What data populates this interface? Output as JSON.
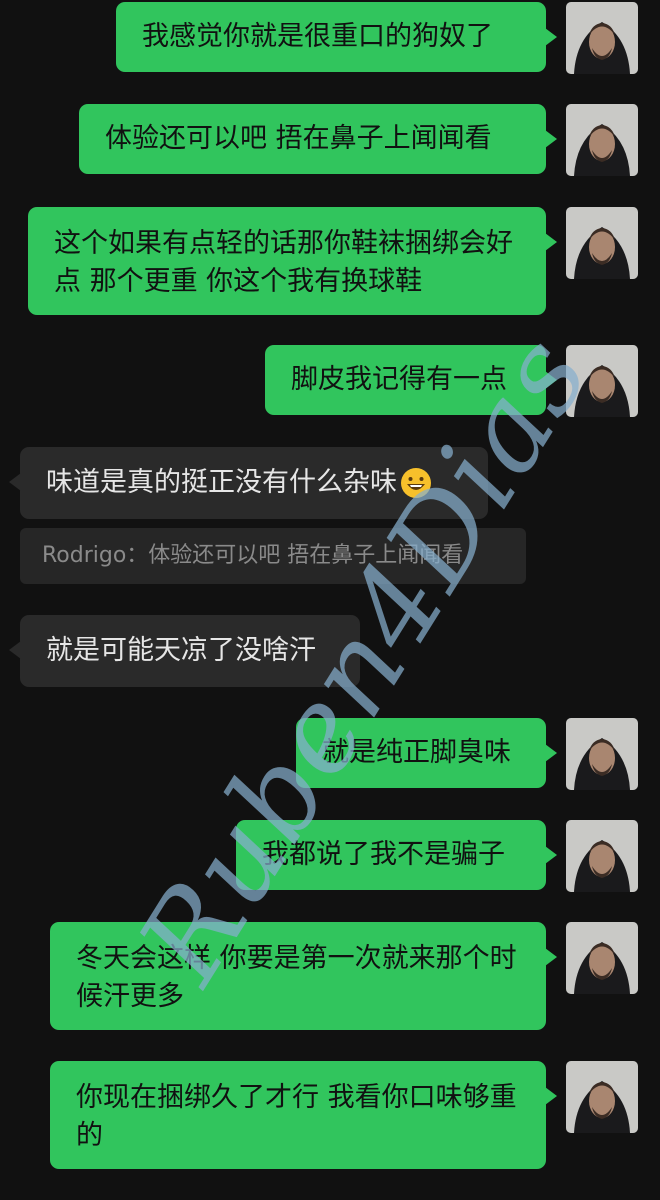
{
  "messages": [
    {
      "side": "out",
      "text": "我感觉你就是很重口的狗奴了"
    },
    {
      "side": "out",
      "text": "体验还可以吧 捂在鼻子上闻闻看"
    },
    {
      "side": "out",
      "text": "这个如果有点轻的话那你鞋袜捆绑会好点 那个更重 你这个我有换球鞋"
    },
    {
      "side": "out",
      "text": "脚皮我记得有一点"
    },
    {
      "side": "in",
      "text": "味道是真的挺正没有什么杂味",
      "emoji": "grinning-face-icon"
    },
    {
      "side": "quote",
      "text": "Rodrigo：体验还可以吧 捂在鼻子上闻闻看"
    },
    {
      "side": "in",
      "text": "就是可能天凉了没啥汗"
    },
    {
      "side": "out",
      "text": "就是纯正脚臭味"
    },
    {
      "side": "out",
      "text": "我都说了我不是骗子"
    },
    {
      "side": "out",
      "text": "冬天会这样 你要是第一次就来那个时候汗更多"
    },
    {
      "side": "out",
      "text": "你现在捆绑久了才行 我看你口味够重的"
    }
  ],
  "watermark": "Ruben4Dias",
  "colors": {
    "background": "#111111",
    "outgoing_bubble": "#31c55d",
    "incoming_bubble": "#2a2a2a",
    "quote_bg": "#262626",
    "quote_text": "#8a8a8a",
    "watermark": "#87afcd"
  }
}
